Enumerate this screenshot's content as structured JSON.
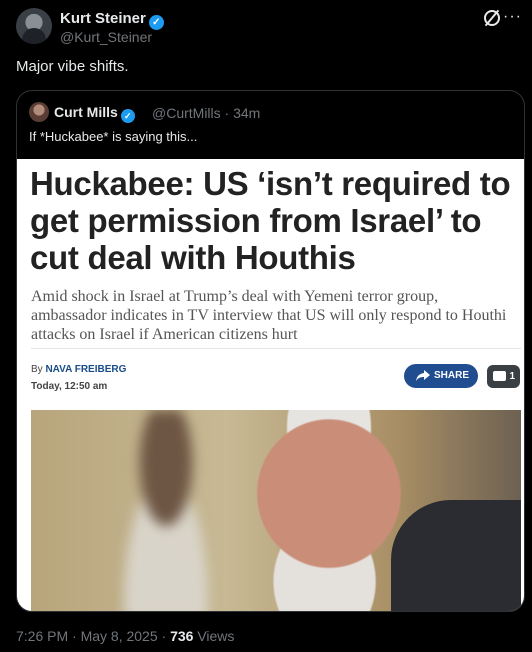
{
  "tweet": {
    "author_name": "Kurt Steiner",
    "author_handle": "@Kurt_Steiner",
    "text": "Major vibe shifts.",
    "timestamp": "7:26 PM · May 8, 2025 · ",
    "views_count": "736",
    "views_label": " Views"
  },
  "quote": {
    "author_name": "Curt Mills",
    "meta": "@CurtMills · 34m",
    "text": "If *Huckabee* is saying this..."
  },
  "article": {
    "headline": "Huckabee: US ‘isn’t required to get permission from Israel’ to cut deal with Houthis",
    "subhead": "Amid shock in Israel at Trump’s deal with Yemeni terror group, ambassador indicates in TV interview that US will only respond to Houthi attacks on Israel if American citizens hurt",
    "byline_prefix": "By ",
    "byline_author": "NAVA FREIBERG",
    "published": "Today, 12:50 am",
    "share_label": "SHARE",
    "comment_count": "1"
  },
  "colors": {
    "verified": "#1d9bf0",
    "share_button": "#1f4d8f"
  },
  "icons": [
    "verified-badge-icon",
    "grok-icon",
    "more-icon",
    "share-icon",
    "comment-icon"
  ]
}
